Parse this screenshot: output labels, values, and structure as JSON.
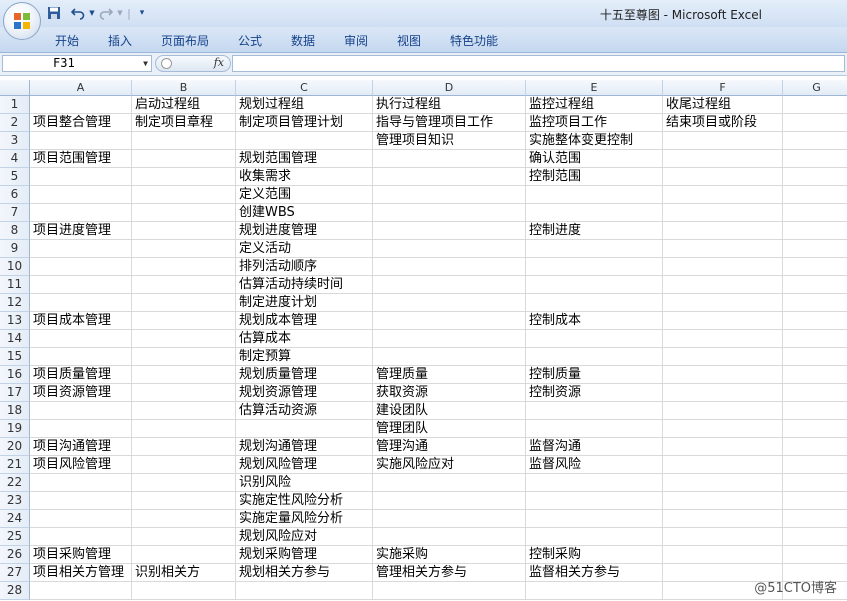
{
  "window": {
    "title": "十五至尊图 - Microsoft Excel"
  },
  "quick_access": {
    "icons": [
      "save-icon",
      "undo-icon",
      "dropdown-arrow-icon",
      "redo-icon",
      "dropdown-arrow-icon",
      "customize-icon"
    ]
  },
  "ribbon": {
    "tabs": [
      "开始",
      "插入",
      "页面布局",
      "公式",
      "数据",
      "审阅",
      "视图",
      "特色功能"
    ]
  },
  "formula_bar": {
    "name_box": "F31",
    "fx_label": "fx",
    "formula": ""
  },
  "sheet": {
    "columns": [
      "A",
      "B",
      "C",
      "D",
      "E",
      "F",
      "G"
    ],
    "rows": [
      [
        "",
        "启动过程组",
        "规划过程组",
        "执行过程组",
        "监控过程组",
        "收尾过程组",
        ""
      ],
      [
        "项目整合管理",
        "制定项目章程",
        "制定项目管理计划",
        "指导与管理项目工作",
        "监控项目工作",
        "结束项目或阶段",
        ""
      ],
      [
        "",
        "",
        "",
        "管理项目知识",
        "实施整体变更控制",
        "",
        ""
      ],
      [
        "项目范围管理",
        "",
        "规划范围管理",
        "",
        "确认范围",
        "",
        ""
      ],
      [
        "",
        "",
        "收集需求",
        "",
        "控制范围",
        "",
        ""
      ],
      [
        "",
        "",
        "定义范围",
        "",
        "",
        "",
        ""
      ],
      [
        "",
        "",
        "创建WBS",
        "",
        "",
        "",
        ""
      ],
      [
        "项目进度管理",
        "",
        "规划进度管理",
        "",
        "控制进度",
        "",
        ""
      ],
      [
        "",
        "",
        "定义活动",
        "",
        "",
        "",
        ""
      ],
      [
        "",
        "",
        "排列活动顺序",
        "",
        "",
        "",
        ""
      ],
      [
        "",
        "",
        "估算活动持续时间",
        "",
        "",
        "",
        ""
      ],
      [
        "",
        "",
        "制定进度计划",
        "",
        "",
        "",
        ""
      ],
      [
        "项目成本管理",
        "",
        "规划成本管理",
        "",
        "控制成本",
        "",
        ""
      ],
      [
        "",
        "",
        "估算成本",
        "",
        "",
        "",
        ""
      ],
      [
        "",
        "",
        "制定预算",
        "",
        "",
        "",
        ""
      ],
      [
        "项目质量管理",
        "",
        "规划质量管理",
        "管理质量",
        "控制质量",
        "",
        ""
      ],
      [
        "项目资源管理",
        "",
        "规划资源管理",
        "获取资源",
        "控制资源",
        "",
        ""
      ],
      [
        "",
        "",
        "估算活动资源",
        "建设团队",
        "",
        "",
        ""
      ],
      [
        "",
        "",
        "",
        "管理团队",
        "",
        "",
        ""
      ],
      [
        "项目沟通管理",
        "",
        "规划沟通管理",
        "管理沟通",
        "监督沟通",
        "",
        ""
      ],
      [
        "项目风险管理",
        "",
        "规划风险管理",
        "实施风险应对",
        "监督风险",
        "",
        ""
      ],
      [
        "",
        "",
        "识别风险",
        "",
        "",
        "",
        ""
      ],
      [
        "",
        "",
        "实施定性风险分析",
        "",
        "",
        "",
        ""
      ],
      [
        "",
        "",
        "实施定量风险分析",
        "",
        "",
        "",
        ""
      ],
      [
        "",
        "",
        "规划风险应对",
        "",
        "",
        "",
        ""
      ],
      [
        "项目采购管理",
        "",
        "规划采购管理",
        "实施采购",
        "控制采购",
        "",
        ""
      ],
      [
        "项目相关方管理",
        "识别相关方",
        "规划相关方参与",
        "管理相关方参与",
        "监督相关方参与",
        "",
        ""
      ],
      [
        "",
        "",
        "",
        "",
        "",
        "",
        ""
      ]
    ]
  },
  "watermark": "@51CTO博客"
}
